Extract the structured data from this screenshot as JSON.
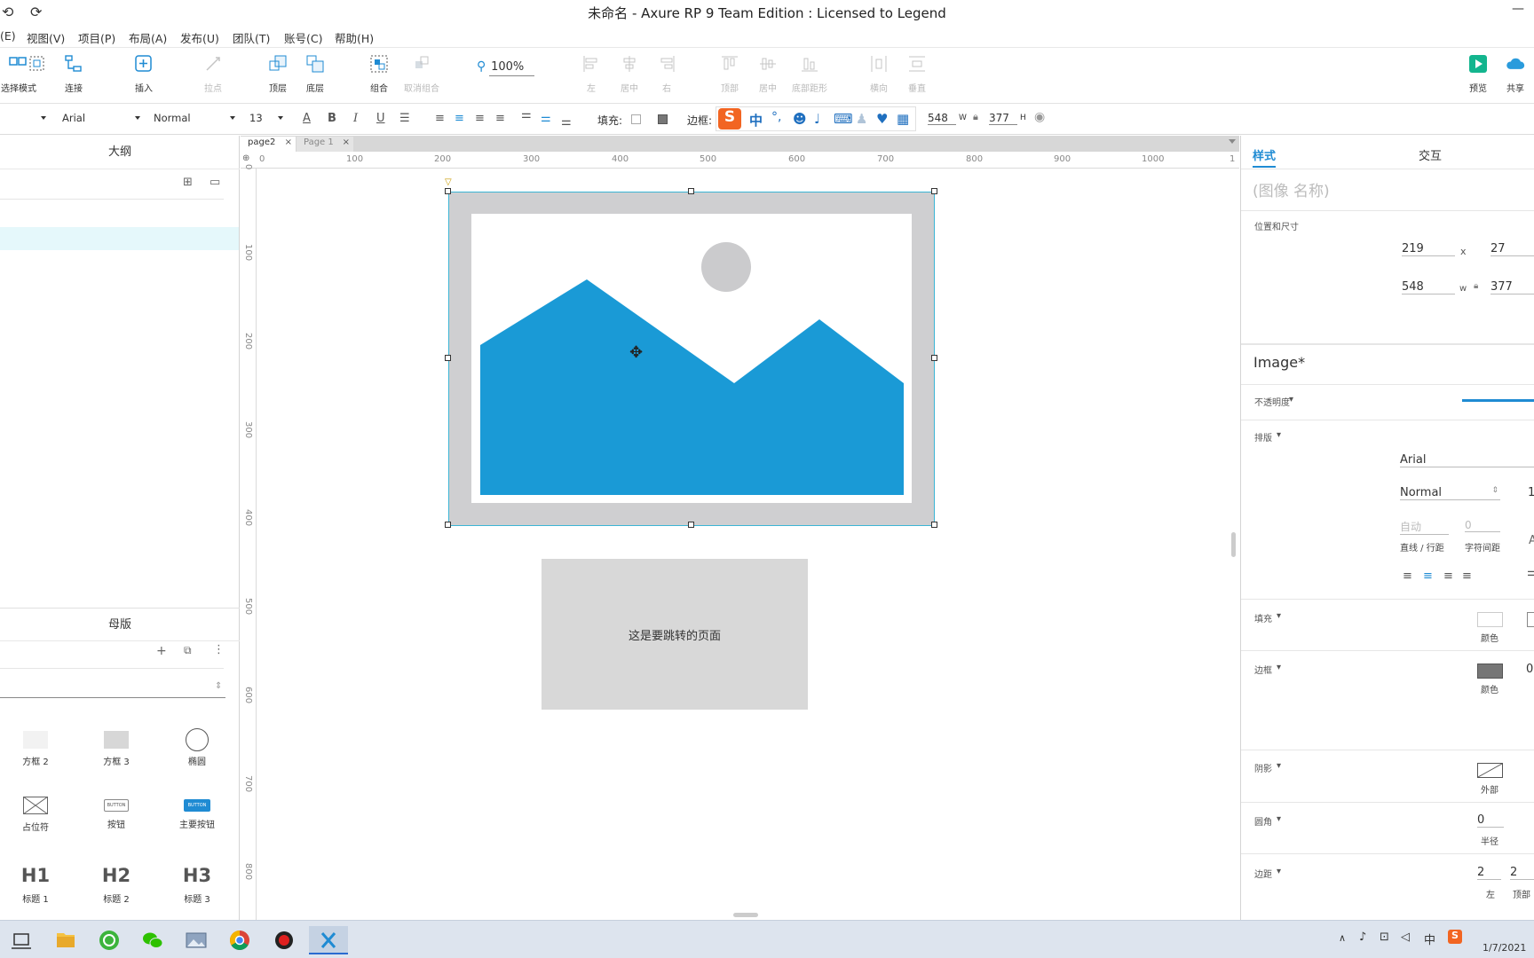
{
  "window": {
    "title": "未命名 - Axure RP 9 Team Edition : Licensed to Legend",
    "minimize_glyph": "—"
  },
  "menu": {
    "items": [
      "(E)",
      "视图(V)",
      "项目(P)",
      "布局(A)",
      "发布(U)",
      "团队(T)",
      "账号(C)",
      "帮助(H)"
    ]
  },
  "toolbar": {
    "select_mode": "选择模式",
    "connect": "连接",
    "insert": "插入",
    "point": "拉点",
    "top_layer": "顶层",
    "bottom_layer": "底层",
    "group": "组合",
    "ungroup": "取消组合",
    "zoom": "100%",
    "align_left": "左",
    "align_center": "居中",
    "align_right": "右",
    "align_top": "顶部",
    "align_middle": "居中",
    "align_bottom": "底部距形",
    "distribute_h": "横向",
    "distribute_v": "垂直",
    "preview": "预览",
    "share": "共享"
  },
  "format": {
    "font_family": "Arial",
    "font_weight": "Normal",
    "font_size": "13",
    "fill_label": "填充:",
    "border_label": "边框:",
    "width": "548",
    "width_unit": "W",
    "height": "377",
    "height_unit": "H",
    "ime": {
      "logo": "S",
      "lang": "中",
      "punct": "°,"
    }
  },
  "left_panel": {
    "outline_title": "大纲",
    "masters_title": "母版",
    "widgets": [
      {
        "label": "方框 2",
        "kind": "box-light"
      },
      {
        "label": "方框 3",
        "kind": "box-dark"
      },
      {
        "label": "椭圆",
        "kind": "ellipse"
      },
      {
        "label": "占位符",
        "kind": "placeholder"
      },
      {
        "label": "按钮",
        "kind": "button"
      },
      {
        "label": "主要按钮",
        "kind": "primary-button"
      },
      {
        "label": "标题 1",
        "kind": "h1"
      },
      {
        "label": "标题 2",
        "kind": "h2"
      },
      {
        "label": "标题 3",
        "kind": "h3"
      }
    ],
    "widget_button_text": "BUTTON",
    "heading_glyphs": [
      "H1",
      "H2",
      "H3"
    ]
  },
  "tabs": [
    {
      "label": "page2",
      "active": true
    },
    {
      "label": "Page 1",
      "active": false
    }
  ],
  "rulers": {
    "h_ticks": [
      "0",
      "100",
      "200",
      "300",
      "400",
      "500",
      "600",
      "700",
      "800",
      "900",
      "1000",
      "1"
    ],
    "v_ticks": [
      "0",
      "100",
      "200",
      "300",
      "400",
      "500",
      "600",
      "700",
      "800"
    ]
  },
  "canvas": {
    "image_widget": {
      "selected": true
    },
    "box_text": "这是要跳转的页面",
    "colors": {
      "mountain": "#1a9ad6",
      "frame": "#cfcfd1",
      "sun": "#cbcbcd",
      "box": "#d8d8d8",
      "selection": "#3cb5d5"
    }
  },
  "right_panel": {
    "tab_style": "样式",
    "tab_interact": "交互",
    "name_placeholder": "(图像 名称)",
    "pos_size_label": "位置和尺寸",
    "x": "219",
    "x_label": "x",
    "y": "27",
    "w": "548",
    "w_label": "w",
    "h": "377",
    "style_name": "Image*",
    "opacity_label": "不透明度",
    "typography_label": "排版",
    "font_family": "Arial",
    "font_weight": "Normal",
    "font_size_partial": "1",
    "line_height_auto": "自动",
    "letter_spacing": "0",
    "line_height_label": "直线 / 行距",
    "letter_spacing_label": "字符间距",
    "fill_label": "填充",
    "fill_color_sub": "颜色",
    "border_label": "边框",
    "border_color_sub": "颜色",
    "border_width": "0",
    "shadow_label": "阴影",
    "shadow_outer_sub": "外部",
    "radius_label": "圆角",
    "radius_value": "0",
    "radius_sub": "半径",
    "padding_label": "边距",
    "padding_left": "2",
    "padding_top": "2",
    "padding_left_sub": "左",
    "padding_top_sub": "顶部"
  },
  "taskbar": {
    "tray_lang": "中",
    "clock": "1/7/2021"
  }
}
